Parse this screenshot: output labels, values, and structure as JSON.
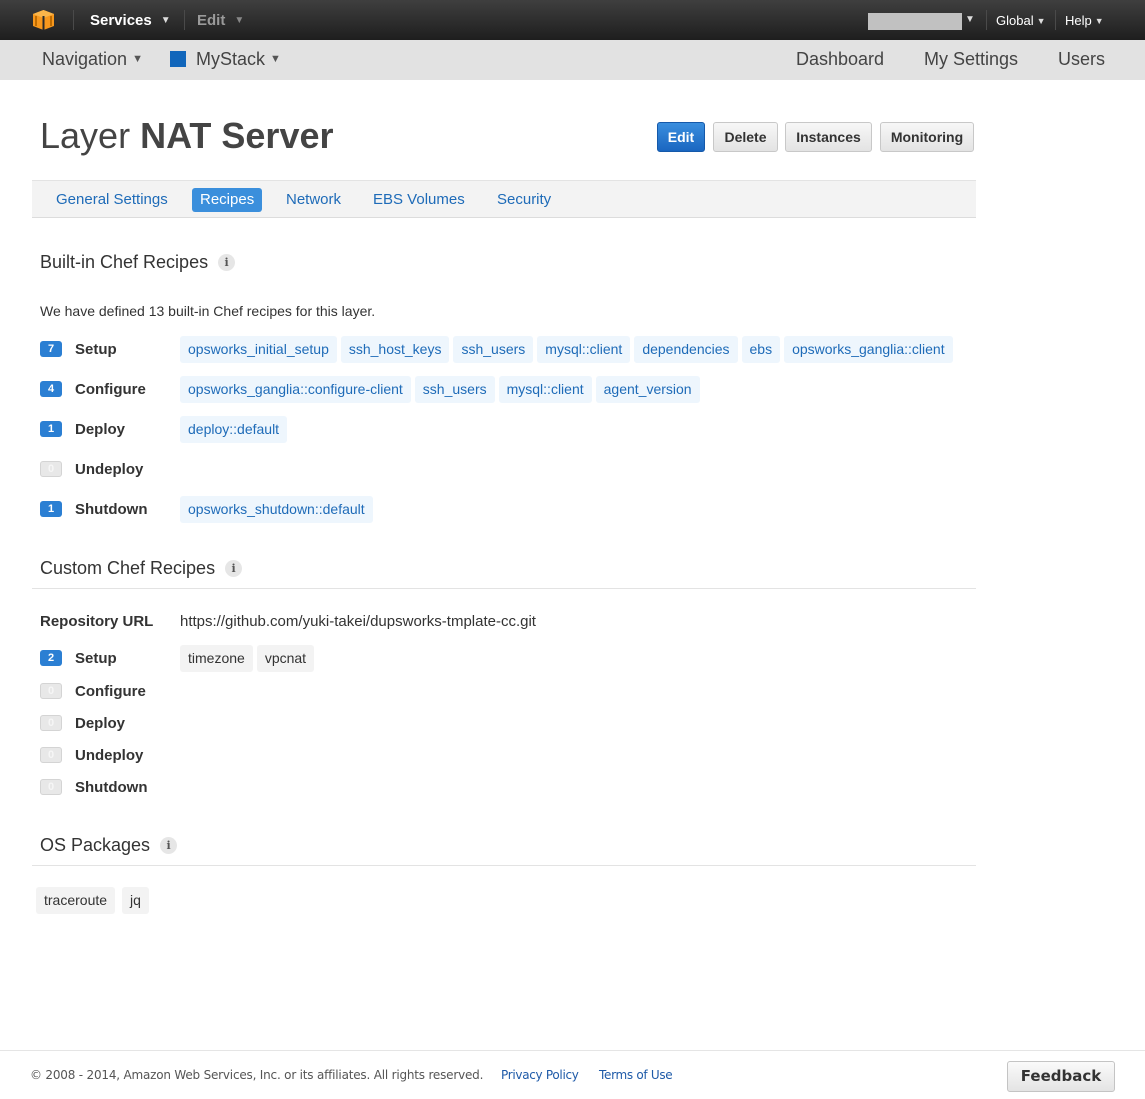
{
  "topbar": {
    "logo_icon": "aws-cube-icon",
    "services_label": "Services",
    "edit_label": "Edit",
    "account_name_redacted": "",
    "region_label": "Global",
    "help_label": "Help"
  },
  "navbar": {
    "navigation_label": "Navigation",
    "stack_label": "MyStack",
    "stack_color": "#1166bb",
    "dashboard_label": "Dashboard",
    "settings_label": "My Settings",
    "users_label": "Users"
  },
  "page": {
    "title_prefix": "Layer",
    "title_name": "NAT Server",
    "actions": {
      "edit": "Edit",
      "delete": "Delete",
      "instances": "Instances",
      "monitoring": "Monitoring"
    }
  },
  "tabs": [
    {
      "label": "General Settings",
      "active": false
    },
    {
      "label": "Recipes",
      "active": true
    },
    {
      "label": "Network",
      "active": false
    },
    {
      "label": "EBS Volumes",
      "active": false
    },
    {
      "label": "Security",
      "active": false
    }
  ],
  "builtin": {
    "title": "Built-in Chef Recipes",
    "description": "We have defined 13 built-in Chef recipes for this layer.",
    "events": [
      {
        "label": "Setup",
        "count": "7",
        "recipes": [
          "opsworks_initial_setup",
          "ssh_host_keys",
          "ssh_users",
          "mysql::client",
          "dependencies",
          "ebs",
          "opsworks_ganglia::client"
        ]
      },
      {
        "label": "Configure",
        "count": "4",
        "recipes": [
          "opsworks_ganglia::configure-client",
          "ssh_users",
          "mysql::client",
          "agent_version"
        ]
      },
      {
        "label": "Deploy",
        "count": "1",
        "recipes": [
          "deploy::default"
        ]
      },
      {
        "label": "Undeploy",
        "count": "0",
        "recipes": []
      },
      {
        "label": "Shutdown",
        "count": "1",
        "recipes": [
          "opsworks_shutdown::default"
        ]
      }
    ]
  },
  "custom": {
    "title": "Custom Chef Recipes",
    "repo_label": "Repository URL",
    "repo_url": "https://github.com/yuki-takei/dupsworks-tmplate-cc.git",
    "events": [
      {
        "label": "Setup",
        "count": "2",
        "recipes": [
          "timezone",
          "vpcnat"
        ]
      },
      {
        "label": "Configure",
        "count": "0",
        "recipes": []
      },
      {
        "label": "Deploy",
        "count": "0",
        "recipes": []
      },
      {
        "label": "Undeploy",
        "count": "0",
        "recipes": []
      },
      {
        "label": "Shutdown",
        "count": "0",
        "recipes": []
      }
    ]
  },
  "os_packages": {
    "title": "OS Packages",
    "packages": [
      "traceroute",
      "jq"
    ]
  },
  "footer": {
    "copyright": "© 2008 - 2014, Amazon Web Services, Inc. or its affiliates. All rights reserved.",
    "privacy": "Privacy Policy",
    "terms": "Terms of Use",
    "feedback": "Feedback"
  }
}
